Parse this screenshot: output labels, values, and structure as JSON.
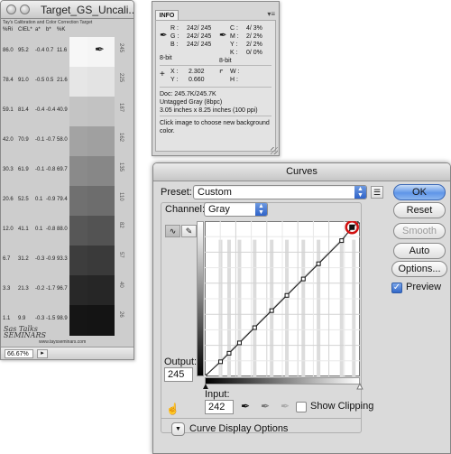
{
  "document": {
    "title": "Target_GS_Uncali...",
    "caption": "Tay's Calibration and Color Correction Target",
    "columns": [
      "%Ri",
      "CIEL*",
      "a*",
      "b*",
      "%K"
    ],
    "rows": [
      {
        "ri": "86.0",
        "l": "95.2",
        "a": "-0.4",
        "b": "0.7",
        "k": "11.6",
        "shade1": "#f7f7f7",
        "shade2": "#f5f5f5",
        "value": "245"
      },
      {
        "ri": "78.4",
        "l": "91.0",
        "a": "-0.5",
        "b": "0.5",
        "k": "21.6",
        "shade1": "#e6e6e6",
        "shade2": "#e3e3e3",
        "value": "225"
      },
      {
        "ri": "59.1",
        "l": "81.4",
        "a": "-0.4",
        "b": "-0.4",
        "k": "40.9",
        "shade1": "#c4c4c4",
        "shade2": "#c2c2c2",
        "value": "187"
      },
      {
        "ri": "42.0",
        "l": "70.9",
        "a": "-0.1",
        "b": "-0.7",
        "k": "58.0",
        "shade1": "#a3a3a3",
        "shade2": "#a0a0a0",
        "value": "162"
      },
      {
        "ri": "30.3",
        "l": "61.9",
        "a": "-0.1",
        "b": "-0.8",
        "k": "69.7",
        "shade1": "#8a8a8a",
        "shade2": "#878787",
        "value": "135"
      },
      {
        "ri": "20.6",
        "l": "52.5",
        "a": "0.1",
        "b": "-0.9",
        "k": "79.4",
        "shade1": "#707070",
        "shade2": "#6d6d6d",
        "value": "110"
      },
      {
        "ri": "12.0",
        "l": "41.1",
        "a": "0.1",
        "b": "-0.8",
        "k": "88.0",
        "shade1": "#575757",
        "shade2": "#535353",
        "value": "82"
      },
      {
        "ri": "6.7",
        "l": "31.2",
        "a": "-0.3",
        "b": "-0.9",
        "k": "93.3",
        "shade1": "#3d3d3d",
        "shade2": "#3a3a3a",
        "value": "57"
      },
      {
        "ri": "3.3",
        "l": "21.3",
        "a": "-0.2",
        "b": "-1.7",
        "k": "96.7",
        "shade1": "#282828",
        "shade2": "#262626",
        "value": "40"
      },
      {
        "ri": "1.1",
        "l": "9.9",
        "a": "-0.3",
        "b": "-1.5",
        "k": "98.9",
        "shade1": "#151515",
        "shade2": "#141414",
        "value": "26"
      }
    ],
    "logo_line1": "Sas Talks",
    "logo_line2": "SEMINARS",
    "url": "www.taysseminars.com",
    "zoom": "66.67%"
  },
  "info": {
    "tab": "INFO",
    "rgb": {
      "r": "R :",
      "g": "G :",
      "b": "B :",
      "r_val": "242/ 245",
      "g_val": "242/ 245",
      "b_val": "242/ 245"
    },
    "cmyk": {
      "c": "C :",
      "m": "M :",
      "y": "Y :",
      "k": "K :",
      "c_val": "4/  3%",
      "m_val": "2/  2%",
      "y_val": "2/  2%",
      "k_val": "0/  0%"
    },
    "bit_left": "8-bit",
    "bit_right": "8-bit",
    "x_label": "X :",
    "y_label": "Y :",
    "x_val": "2.302",
    "y_val": "0.660",
    "w_label": "W :",
    "h_label": "H :",
    "doc_size": "Doc: 245.7K/245.7K",
    "profile": "Untagged Gray (8bpc)",
    "dimensions": "3.05 inches x 8.25 inches (100 ppi)",
    "hint": "Click image to choose new background color."
  },
  "curves": {
    "title": "Curves",
    "preset_label": "Preset:",
    "preset_value": "Custom",
    "channel_label": "Channel:",
    "channel_value": "Gray",
    "output_label": "Output:",
    "output_value": "245",
    "input_label": "Input:",
    "input_value": "242",
    "show_clipping": "Show Clipping",
    "display_options": "Curve Display Options",
    "buttons": {
      "ok": "OK",
      "reset": "Reset",
      "smooth": "Smooth",
      "auto": "Auto",
      "options": "Options...",
      "preview": "Preview"
    },
    "accent": "#d01010",
    "curve_points": [
      [
        0,
        0
      ],
      [
        26,
        24
      ],
      [
        40,
        38
      ],
      [
        57,
        55
      ],
      [
        82,
        80
      ],
      [
        110,
        108
      ],
      [
        135,
        133
      ],
      [
        162,
        160
      ],
      [
        187,
        185
      ],
      [
        225,
        223
      ],
      [
        242,
        245
      ],
      [
        255,
        255
      ]
    ],
    "selected_point": [
      242,
      245
    ]
  }
}
